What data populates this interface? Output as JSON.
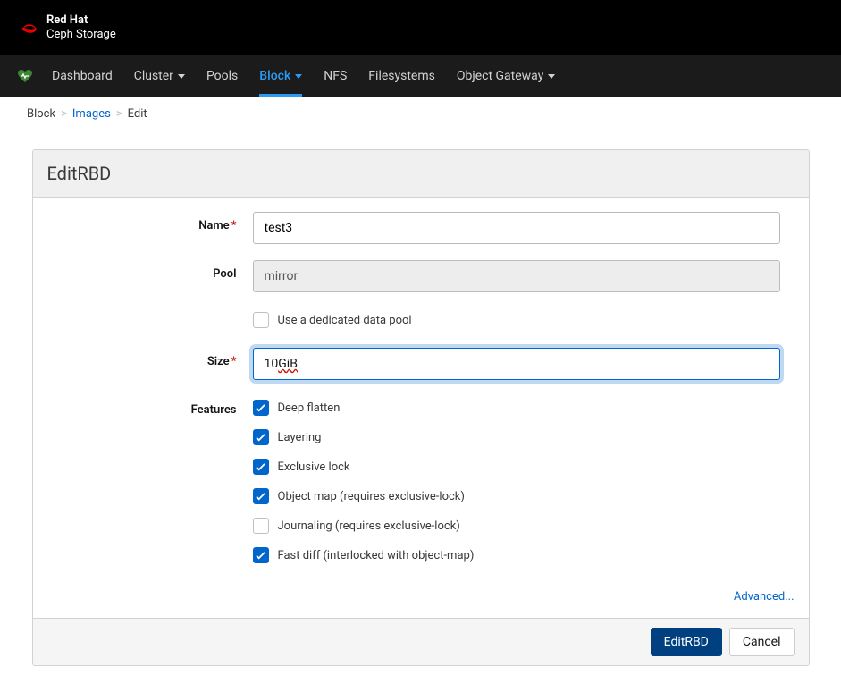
{
  "brand": {
    "name": "Red Hat",
    "product": "Ceph Storage"
  },
  "nav": {
    "items": [
      {
        "label": "Dashboard",
        "has_caret": false
      },
      {
        "label": "Cluster",
        "has_caret": true
      },
      {
        "label": "Pools",
        "has_caret": false
      },
      {
        "label": "Block",
        "has_caret": true,
        "active": true
      },
      {
        "label": "NFS",
        "has_caret": false
      },
      {
        "label": "Filesystems",
        "has_caret": false
      },
      {
        "label": "Object Gateway",
        "has_caret": true
      }
    ]
  },
  "breadcrumb": {
    "items": [
      {
        "label": "Block",
        "link": false
      },
      {
        "label": "Images",
        "link": true
      },
      {
        "label": "Edit",
        "link": false
      }
    ]
  },
  "panel": {
    "title": "EditRBD"
  },
  "form": {
    "name": {
      "label": "Name",
      "value": "test3",
      "required": true
    },
    "pool": {
      "label": "Pool",
      "value": "mirror",
      "required": false,
      "disabled": true
    },
    "dedicated_pool": {
      "label": "Use a dedicated data pool",
      "checked": false
    },
    "size": {
      "label": "Size",
      "value_prefix": "10 ",
      "value_unit": "GiB",
      "required": true,
      "focused": true
    },
    "features": {
      "label": "Features",
      "items": [
        {
          "label": "Deep flatten",
          "checked": true
        },
        {
          "label": "Layering",
          "checked": true
        },
        {
          "label": "Exclusive lock",
          "checked": true
        },
        {
          "label": "Object map (requires exclusive-lock)",
          "checked": true
        },
        {
          "label": "Journaling (requires exclusive-lock)",
          "checked": false
        },
        {
          "label": "Fast diff (interlocked with object-map)",
          "checked": true
        }
      ]
    },
    "advanced_label": "Advanced..."
  },
  "footer": {
    "submit": "EditRBD",
    "cancel": "Cancel"
  }
}
